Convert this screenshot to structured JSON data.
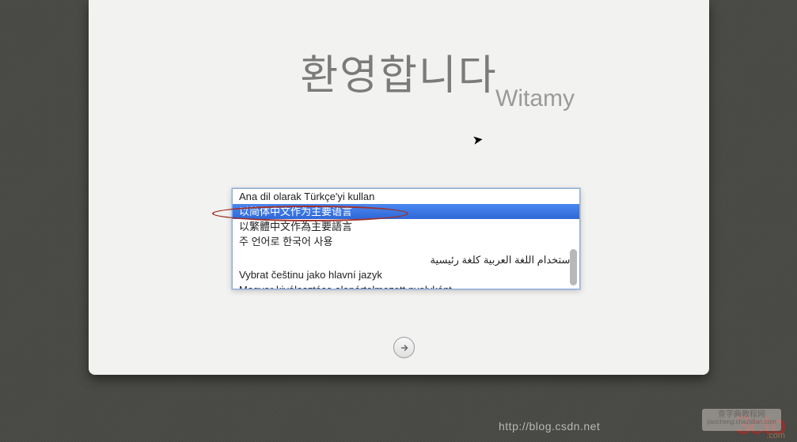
{
  "welcome": {
    "large": "환영합니다",
    "small": "Witamy"
  },
  "language_list": [
    {
      "label": "Ana dil olarak Türkçe'yi kullan",
      "selected": false,
      "rtl": false
    },
    {
      "label": "以简体中文作为主要语言",
      "selected": true,
      "rtl": false
    },
    {
      "label": "以繁體中文作為主要語言",
      "selected": false,
      "rtl": false
    },
    {
      "label": "주 언어로 한국어 사용",
      "selected": false,
      "rtl": false
    },
    {
      "label": "استخدام اللغة العربية كلغة رئيسية",
      "selected": false,
      "rtl": true
    },
    {
      "label": "Vybrat češtinu jako hlavní jazyk",
      "selected": false,
      "rtl": false
    },
    {
      "label": "Magyar kiválasztása alapértelmezett nyelvként",
      "selected": false,
      "rtl": false
    }
  ],
  "continue": {
    "icon": "arrow-right"
  },
  "watermarks": {
    "url": "http://blog.csdn.net",
    "logo_main": "3cto",
    "logo_com": ".com",
    "stamp_line1": "查字典教程网",
    "stamp_line2": "jiaocheng.chazidian.com"
  }
}
